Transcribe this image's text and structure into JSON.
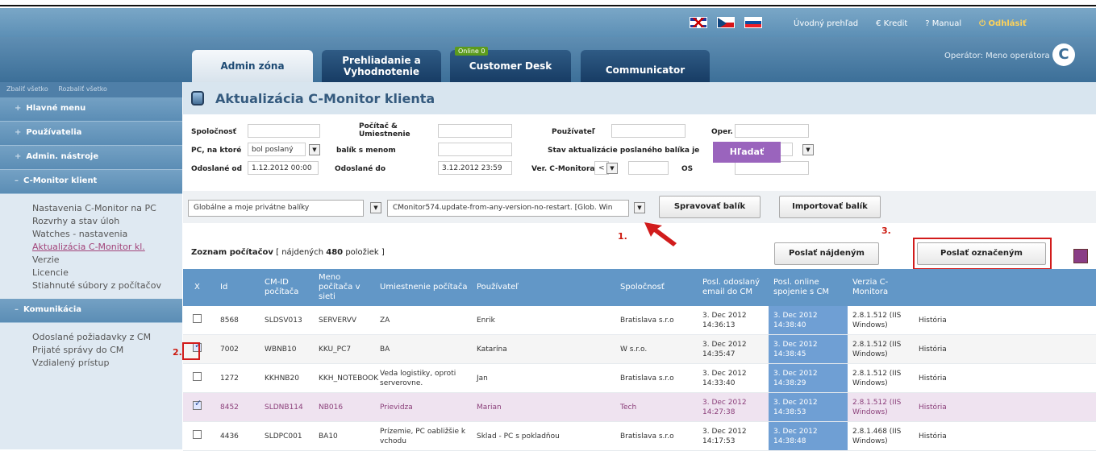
{
  "topbar": {
    "links": {
      "overview": "Úvodný prehľad",
      "credit": "Kredit",
      "manual": "Manual",
      "logout": "Odhlásiť"
    }
  },
  "tabs": {
    "admin": "Admin zóna",
    "review": "Prehliadanie a Vyhodnotenie",
    "customer": "Customer Desk",
    "communicator": "Communicator",
    "online_badge": "Online",
    "online_count": "0"
  },
  "operator": "Operátor: Meno operátora",
  "sidebar": {
    "top": {
      "collapse": "Zbaliť všetko",
      "expand": "Rozbaliť všetko"
    },
    "sections": [
      {
        "label": "Hlavné menu",
        "sign": "+"
      },
      {
        "label": "Používatelia",
        "sign": "+"
      },
      {
        "label": "Admin. nástroje",
        "sign": "+"
      },
      {
        "label": "C-Monitor klient",
        "sign": "–"
      }
    ],
    "items": [
      "Nastavenia C-Monitor na PC",
      "Rozvrhy a stav úloh",
      "Watches - nastavenia",
      "Aktualizácia C-Monitor kl.",
      "Verzie",
      "Licencie",
      "Stiahnuté súbory z počítačov"
    ],
    "comm": {
      "label": "Komunikácia",
      "sign": "–"
    },
    "comm_items": [
      "Odoslané požiadavky z CM",
      "Prijaté správy do CM",
      "Vzdialený prístup"
    ]
  },
  "page": {
    "title": "Aktualizácia C-Monitor klienta"
  },
  "filters": {
    "company": "Spoločnosť",
    "computer": "Počítač & Umiestnenie",
    "user": "Používateľ",
    "oper": "Oper.",
    "pc_sent": "PC, na ktoré",
    "pc_sent_value": "bol poslaný",
    "package": "balík s menom",
    "state": "Stav aktualizácie poslaného balíka je",
    "sent_from": "Odoslané od",
    "sent_from_value": "1.12.2012 00:00",
    "sent_to": "Odoslané do",
    "sent_to_value": "3.12.2012 23:59",
    "version": "Ver. C-Monitora",
    "version_value": "<",
    "os": "OS",
    "search": "Hľadať"
  },
  "toolbar": {
    "packages": "Globálne a moje privátne balíky",
    "selected_package": "CMonitor574.update-from-any-version-no-restart. [Glob. Win",
    "manage": "Spravovať balík",
    "import": "Importovať balík"
  },
  "annotations": [
    "1.",
    "2.",
    "3."
  ],
  "list": {
    "label": "Zoznam počítačov",
    "found_prefix": "[ nájdených",
    "found_count": "480",
    "found_suffix": "položiek ]",
    "send_found": "Poslať nájdeným",
    "send_selected": "Poslať označeným"
  },
  "table": {
    "headers": [
      "X",
      "Id",
      "CM-ID počítača",
      "Meno počítača v sieti",
      "Umiestnenie počítača",
      "Používateľ",
      "Spoločnosť",
      "Posl. odoslaný email do CM",
      "Posl. online spojenie s CM",
      "Verzia C-Monitora",
      ""
    ],
    "rows": [
      {
        "checked": false,
        "cells": [
          "8568",
          "SLDSV013",
          "SERVERVV",
          "ZA",
          "Enrik",
          "Bratislava s.r.o",
          "3. Dec 2012 14:36:13",
          "3. Dec 2012 14:38:40",
          "2.8.1.512 (IIS Windows)",
          "História"
        ]
      },
      {
        "checked": true,
        "cells": [
          "7002",
          "WBNB10",
          "KKU_PC7",
          "BA",
          "Katarína",
          "W s.r.o.",
          "3. Dec 2012 14:35:47",
          "3. Dec 2012 14:38:45",
          "2.8.1.512 (IIS Windows)",
          "História"
        ]
      },
      {
        "checked": false,
        "cells": [
          "1272",
          "KKHNB20",
          "KKH_NOTEBOOK",
          "Veda logistiky, oproti serverovne.",
          "Jan",
          "Bratislava s.r.o",
          "3. Dec 2012 14:33:40",
          "3. Dec 2012 14:38:29",
          "2.8.1.512 (IIS Windows)",
          "História"
        ]
      },
      {
        "checked": true,
        "cells": [
          "8452",
          "SLDNB114",
          "NB016",
          "Prievidza",
          "Marian",
          "Tech",
          "3. Dec 2012 14:27:38",
          "3. Dec 2012 14:38:53",
          "2.8.1.512 (IIS Windows)",
          "História"
        ]
      },
      {
        "checked": false,
        "cells": [
          "4436",
          "SLDPC001",
          "BA10",
          "Prízemie, PC oabližšie k vchodu",
          "Sklad - PC s pokladňou",
          "Bratislava s.r.o",
          "3. Dec 2012 14:17:53",
          "3. Dec 2012 14:38:48",
          "2.8.1.468 (IIS Windows)",
          "História"
        ]
      }
    ]
  }
}
